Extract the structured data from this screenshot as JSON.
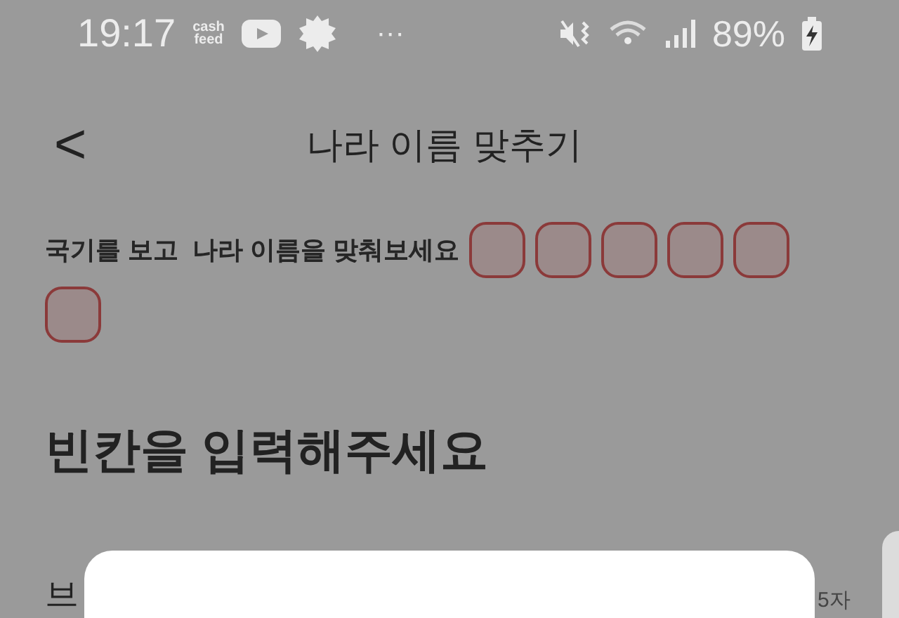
{
  "status_bar": {
    "time": "19:17",
    "app_logo": [
      "cash",
      "feed"
    ],
    "more": "···",
    "battery": "89%"
  },
  "header": {
    "back": "<",
    "title": "나라 이름 맞추기"
  },
  "instruction": "국기를 보고  나라 이름을 맞춰보세요",
  "answer_slots": [
    {
      "filled": false
    },
    {
      "filled": false
    },
    {
      "filled": false
    },
    {
      "filled": false
    },
    {
      "filled": false
    },
    {
      "filled": false
    }
  ],
  "heading": "빈칸을 입력해주세요",
  "field_label": "브",
  "field_counter": "5자"
}
